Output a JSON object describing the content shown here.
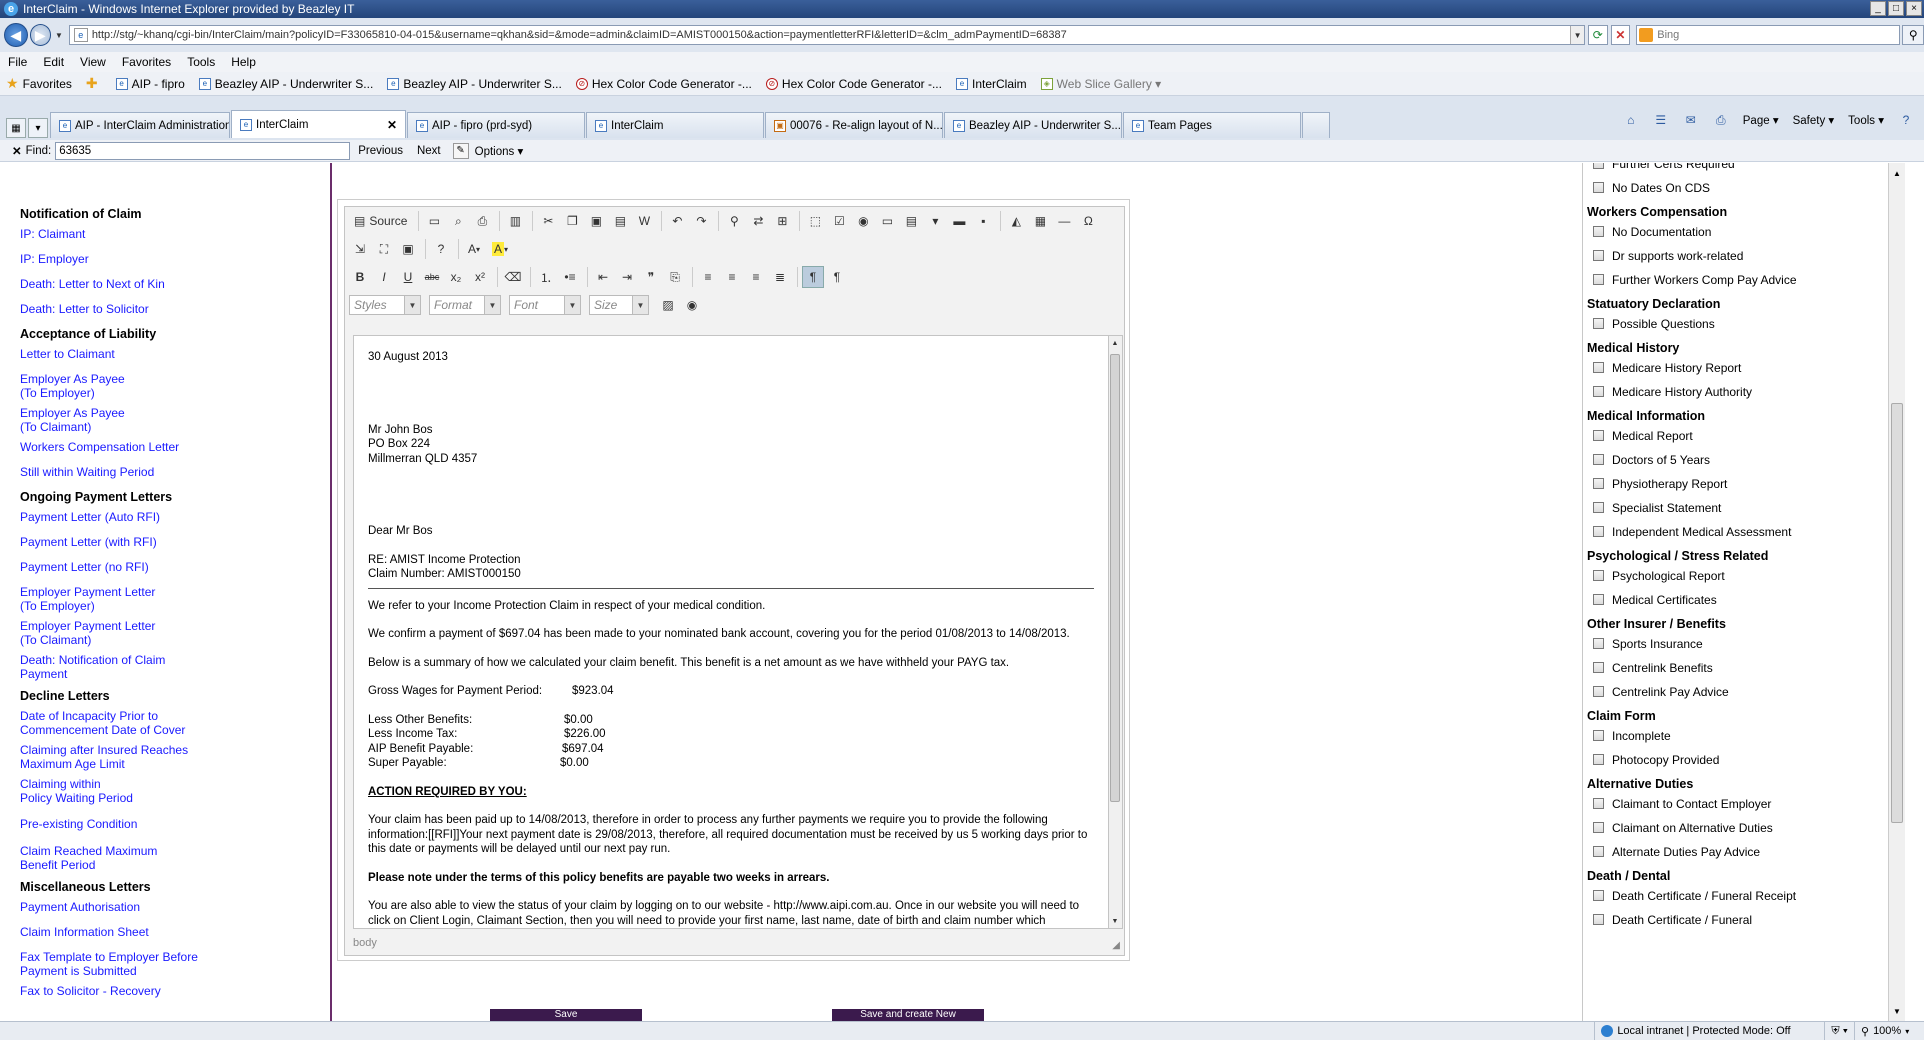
{
  "window": {
    "title": "InterClaim - Windows Internet Explorer provided by Beazley IT",
    "controls": [
      "_",
      "□",
      "×"
    ]
  },
  "address": {
    "url": "http://stg/~khanq/cgi-bin/InterClaim/main?policyID=F33065810-04-015&username=qkhan&sid=&mode=admin&claimID=AMIST000150&action=paymentletterRFI&letterID=&clm_admPaymentID=68387",
    "search_placeholder": "Bing"
  },
  "menu": [
    "File",
    "Edit",
    "View",
    "Favorites",
    "Tools",
    "Help"
  ],
  "favorites": {
    "label": "Favorites",
    "items": [
      {
        "label": "AIP - fipro",
        "icon": "ie-page-icon"
      },
      {
        "label": "Beazley AIP - Underwriter S...",
        "icon": "ie-page-icon"
      },
      {
        "label": "Beazley AIP - Underwriter S...",
        "icon": "ie-page-icon"
      },
      {
        "label": "Hex Color Code Generator -...",
        "icon": "hex-icon"
      },
      {
        "label": "Hex Color Code Generator -...",
        "icon": "hex-icon"
      },
      {
        "label": "InterClaim",
        "icon": "ie-page-icon"
      },
      {
        "label": "Web Slice Gallery ▾",
        "icon": "web-slice-icon"
      }
    ]
  },
  "tabs": [
    {
      "label": "AIP - InterClaim Administration",
      "width": 0
    },
    {
      "label": "InterClaim",
      "active": true
    },
    {
      "label": "AIP - fipro (prd-syd)"
    },
    {
      "label": "InterClaim"
    },
    {
      "label": "00076 - Re-align layout of N..."
    },
    {
      "label": "Beazley AIP - Underwriter S..."
    },
    {
      "label": "Team Pages"
    }
  ],
  "commands": {
    "page": "Page ▾",
    "safety": "Safety ▾",
    "tools": "Tools ▾",
    "help": "?"
  },
  "find": {
    "label": "Find:",
    "value": "63635",
    "previous": "Previous",
    "next": "Next",
    "options": "Options ▾"
  },
  "leftnav": [
    {
      "type": "heading",
      "label": "Notification of Claim"
    },
    {
      "type": "link",
      "label": "IP: Claimant"
    },
    {
      "type": "link",
      "label": "IP: Employer"
    },
    {
      "type": "link",
      "label": "Death: Letter to Next of Kin"
    },
    {
      "type": "link",
      "label": "Death: Letter to Solicitor"
    },
    {
      "type": "heading",
      "label": "Acceptance of Liability"
    },
    {
      "type": "link",
      "label": "Letter to Claimant"
    },
    {
      "type": "link",
      "label": "Employer As Payee\n(To Employer)"
    },
    {
      "type": "link",
      "label": "Employer As Payee\n(To Claimant)"
    },
    {
      "type": "link",
      "label": "Workers Compensation Letter"
    },
    {
      "type": "link",
      "label": "Still within Waiting Period"
    },
    {
      "type": "heading",
      "label": "Ongoing Payment Letters"
    },
    {
      "type": "link",
      "label": "Payment Letter (Auto RFI)"
    },
    {
      "type": "link",
      "label": "Payment Letter (with RFI)"
    },
    {
      "type": "link",
      "label": "Payment Letter (no RFI)"
    },
    {
      "type": "link",
      "label": "Employer Payment Letter\n(To Employer)"
    },
    {
      "type": "link",
      "label": "Employer Payment Letter\n(To Claimant)"
    },
    {
      "type": "link",
      "label": "Death: Notification of Claim\nPayment"
    },
    {
      "type": "heading",
      "label": "Decline Letters"
    },
    {
      "type": "link",
      "label": "Date of Incapacity Prior to\nCommencement Date of Cover"
    },
    {
      "type": "link",
      "label": "Claiming after Insured Reaches\nMaximum Age Limit"
    },
    {
      "type": "link",
      "label": "Claiming within\nPolicy Waiting Period"
    },
    {
      "type": "link",
      "label": "Pre-existing Condition"
    },
    {
      "type": "link",
      "label": "Claim Reached Maximum\nBenefit Period"
    },
    {
      "type": "heading",
      "label": "Miscellaneous Letters"
    },
    {
      "type": "link",
      "label": "Payment Authorisation"
    },
    {
      "type": "link",
      "label": "Claim Information Sheet"
    },
    {
      "type": "link",
      "label": "Fax Template to Employer Before\nPayment is Submitted"
    },
    {
      "type": "link",
      "label": "Fax to Solicitor - Recovery"
    }
  ],
  "editor": {
    "source_label": "Source",
    "styles_placeholder": "Styles",
    "format_placeholder": "Format",
    "font_placeholder": "Font",
    "size_placeholder": "Size",
    "status": "body"
  },
  "letter": {
    "date": "30 August 2013",
    "addressee": [
      "Mr John Bos",
      "PO Box 224",
      "Millmerran QLD 4357"
    ],
    "salutation": "Dear Mr Bos",
    "re": "RE: AMIST Income Protection",
    "claim_number": "Claim Number: AMIST000150",
    "p1": "We refer to your Income Protection Claim in respect of your medical condition.",
    "p2": "We confirm a payment of $697.04 has been made to your nominated bank account, covering you for the period 01/08/2013 to 14/08/2013.",
    "p3": "Below is a summary of how we calculated your claim benefit. This benefit is a net amount as we have withheld your PAYG tax.",
    "gross": {
      "label": "Gross Wages for Payment Period:",
      "value": "$923.04"
    },
    "summary": [
      {
        "label": "Less Other Benefits:",
        "value": "$0.00"
      },
      {
        "label": "Less Income Tax:",
        "value": "$226.00"
      },
      {
        "label": "AIP Benefit Payable:",
        "value": "$697.04"
      },
      {
        "label": "Super Payable:",
        "value": "$0.00"
      }
    ],
    "action_heading": "ACTION REQUIRED BY YOU:",
    "p4": "Your claim has been paid up to 14/08/2013, therefore in order to process any further payments we require you to provide the following information:[[RFI]]Your next payment date is 29/08/2013, therefore, all required documentation must be received by us 5 working days prior to this date or payments will be delayed until our next pay run.",
    "p5": "Please note under the terms of this policy benefits are payable two weeks in arrears.",
    "p6": "You are also able to view the status of your claim by logging on to our website - http://www.aipi.com.au. Once in our website you will need to click on Client Login, Claimant Section, then you will need to provide your first name, last name, date of birth and claim number which"
  },
  "buttons": {
    "save": "Save",
    "save_create": "Save and create New"
  },
  "rightpanel": {
    "top_items": [
      {
        "label": "Further Certs Required"
      },
      {
        "label": "No Dates On CDS"
      }
    ],
    "groups": [
      {
        "heading": "Workers Compensation",
        "items": [
          "No Documentation",
          "Dr supports work-related",
          "Further Workers Comp Pay Advice"
        ]
      },
      {
        "heading": "Statuatory Declaration",
        "items": [
          "Possible Questions"
        ]
      },
      {
        "heading": "Medical History",
        "items": [
          "Medicare History Report",
          "Medicare History Authority"
        ]
      },
      {
        "heading": "Medical Information",
        "items": [
          "Medical Report",
          "Doctors of 5 Years",
          "Physiotherapy Report",
          "Specialist Statement",
          "Independent Medical Assessment"
        ]
      },
      {
        "heading": "Psychological / Stress Related",
        "items": [
          "Psychological Report",
          "Medical Certificates"
        ]
      },
      {
        "heading": "Other Insurer / Benefits",
        "items": [
          "Sports Insurance",
          "Centrelink Benefits",
          "Centrelink Pay Advice"
        ]
      },
      {
        "heading": "Claim Form",
        "items": [
          "Incomplete",
          "Photocopy Provided"
        ]
      },
      {
        "heading": "Alternative Duties",
        "items": [
          "Claimant to Contact Employer",
          "Claimant on Alternative Duties",
          "Alternate Duties Pay Advice"
        ]
      },
      {
        "heading": "Death / Dental",
        "items": [
          "Death Certificate / Funeral Receipt",
          "Death Certificate / Funeral"
        ]
      }
    ]
  },
  "status": {
    "zone": "Local intranet | Protected Mode: Off",
    "zoom": "100%"
  }
}
